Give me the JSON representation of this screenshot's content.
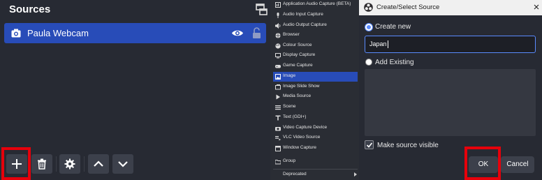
{
  "sources": {
    "title": "Sources",
    "items": [
      {
        "name": "Paula Webcam",
        "icon": "camera-icon"
      }
    ],
    "toolbar": [
      "add-icon",
      "trash-icon",
      "gear-icon",
      "chevron-up-icon",
      "chevron-down-icon"
    ]
  },
  "menu": {
    "items": [
      {
        "label": "Application Audio Capture (BETA)",
        "icon": "app-audio-icon"
      },
      {
        "label": "Audio Input Capture",
        "icon": "microphone-icon"
      },
      {
        "label": "Audio Output Capture",
        "icon": "speaker-icon"
      },
      {
        "label": "Browser",
        "icon": "globe-icon"
      },
      {
        "label": "Colour Source",
        "icon": "palette-icon"
      },
      {
        "label": "Display Capture",
        "icon": "monitor-icon"
      },
      {
        "label": "Game Capture",
        "icon": "gamepad-icon"
      },
      {
        "label": "Image",
        "icon": "image-icon",
        "selected": true
      },
      {
        "label": "Image Slide Show",
        "icon": "slideshow-icon"
      },
      {
        "label": "Media Source",
        "icon": "play-icon"
      },
      {
        "label": "Scene",
        "icon": "list-icon"
      },
      {
        "label": "Text (GDI+)",
        "icon": "text-icon"
      },
      {
        "label": "Video Capture Device",
        "icon": "camera-icon"
      },
      {
        "label": "VLC Video Source",
        "icon": "playlist-icon"
      },
      {
        "label": "Window Capture",
        "icon": "window-icon"
      },
      {
        "label": "Group",
        "icon": "folder-icon"
      },
      {
        "label": "Deprecated",
        "icon": ""
      }
    ]
  },
  "dialog": {
    "title": "Create/Select Source",
    "create_new_label": "Create new",
    "name_value": "Japan",
    "add_existing_label": "Add Existing",
    "visible_label": "Make source visible",
    "ok_label": "OK",
    "cancel_label": "Cancel"
  },
  "colors": {
    "accent": "#284cb8",
    "highlight": "#e6000b",
    "panel": "#272a33",
    "button": "#3c404b"
  }
}
